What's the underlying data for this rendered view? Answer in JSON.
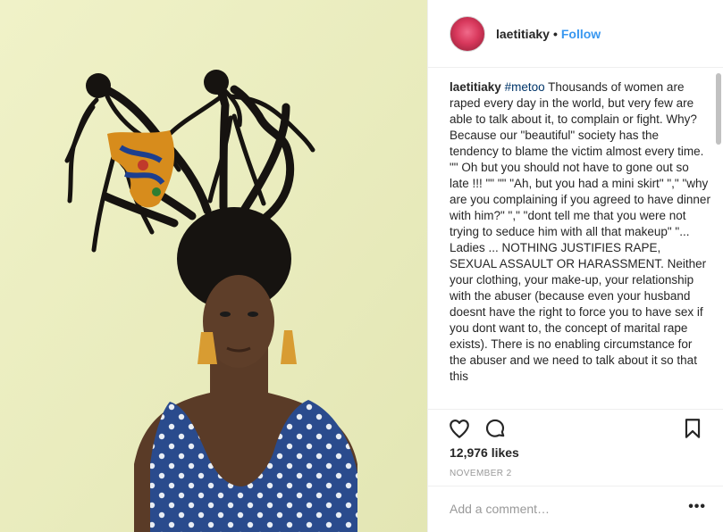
{
  "post": {
    "photo_icon": "post-photo"
  },
  "header": {
    "avatar_icon": "avatar",
    "username": "laetitiaky",
    "separator": "•",
    "follow_label": "Follow"
  },
  "caption": {
    "username": "laetitiaky",
    "hashtag": "#metoo",
    "text": "Thousands of women are raped every day in the world, but very few are able to talk about it, to complain or fight. Why? Because our \"beautiful\" society has the tendency to blame the victim almost every time. \"\" Oh but you should not have to gone out so late !!! \"\" \"\" \"Ah, but you had a mini skirt\" \",\" \"why are you complaining if you agreed to have dinner with him?\" \",\" \"dont tell me that you were not trying to seduce him with all that makeup\" \"... Ladies ... NOTHING JUSTIFIES RAPE, SEXUAL ASSAULT OR HARASSMENT. Neither your clothing, your make-up, your relationship with the abuser (because even your husband doesnt have the right to force you to have sex if you dont want to, the concept of marital rape exists). There is no enabling circumstance for the abuser and we need to talk about it so that this"
  },
  "actions": {
    "like_icon": "heart-icon",
    "comment_icon": "comment-icon",
    "save_icon": "bookmark-icon"
  },
  "stats": {
    "likes": "12,976 likes",
    "date": "NOVEMBER 2"
  },
  "comment_box": {
    "placeholder": "Add a comment…",
    "more_label": "•••"
  },
  "colors": {
    "link_blue": "#3897f0",
    "hashtag": "#003569",
    "photo_bg": "#ecedc0",
    "dress_blue": "#2a4b8d"
  }
}
